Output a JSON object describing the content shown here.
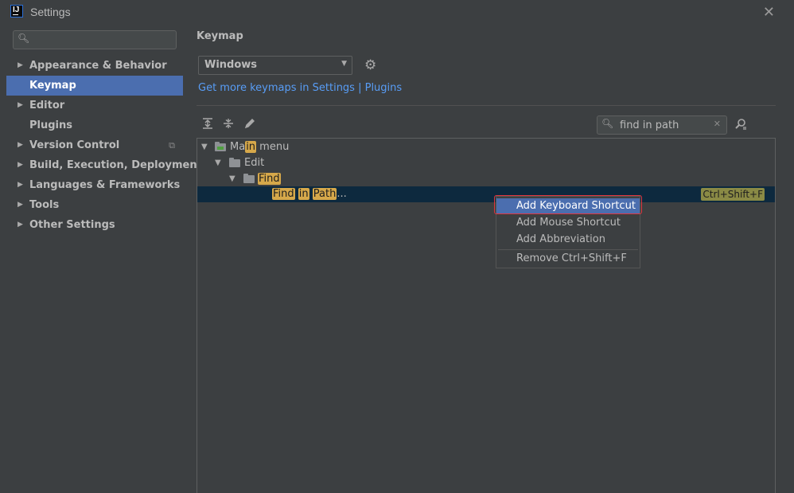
{
  "window": {
    "logo_text": "IJ",
    "title": "Settings",
    "close_glyph": "✕"
  },
  "sidebar": {
    "search": {
      "value": "",
      "placeholder": ""
    },
    "items": [
      {
        "label": "Appearance & Behavior",
        "expandable": true,
        "selected": false
      },
      {
        "label": "Keymap",
        "expandable": false,
        "selected": true
      },
      {
        "label": "Editor",
        "expandable": true,
        "selected": false
      },
      {
        "label": "Plugins",
        "expandable": false,
        "selected": false
      },
      {
        "label": "Version Control",
        "expandable": true,
        "selected": false,
        "icon": "copy-icon"
      },
      {
        "label": "Build, Execution, Deployment",
        "expandable": true,
        "selected": false
      },
      {
        "label": "Languages & Frameworks",
        "expandable": true,
        "selected": false
      },
      {
        "label": "Tools",
        "expandable": true,
        "selected": false
      },
      {
        "label": "Other Settings",
        "expandable": true,
        "selected": false
      }
    ]
  },
  "main": {
    "title": "Keymap",
    "keymap_select": {
      "value": "Windows"
    },
    "more_keymaps_link": "Get more keymaps in Settings | Plugins",
    "toolbar": {
      "icons": [
        "expand-all-icon",
        "collapse-all-icon",
        "edit-icon"
      ],
      "search": {
        "value": "find in path",
        "placeholder": ""
      },
      "find_by_shortcut_icon": "find-shortcut-icon"
    },
    "tree": {
      "rows": [
        {
          "pre": "Ma",
          "hl": "in",
          "post": " menu",
          "icon": "main-menu-folder-icon"
        },
        {
          "label": "Edit",
          "icon": "folder-icon"
        },
        {
          "hl": "Find",
          "icon": "folder-icon"
        },
        {
          "hl1": "Find",
          "hl2": "in",
          "hl3": "Path",
          "suffix": "...",
          "shortcut": "Ctrl+Shift+F",
          "selected": true
        }
      ]
    }
  },
  "context_menu": {
    "items": [
      {
        "label": "Add Keyboard Shortcut",
        "active": true
      },
      {
        "label": "Add Mouse Shortcut",
        "active": false
      },
      {
        "label": "Add Abbreviation",
        "active": false
      },
      {
        "label": "Remove Ctrl+Shift+F",
        "active": false
      }
    ]
  },
  "colors": {
    "background": "#3c3f41",
    "selection_blue": "#4b6eaf",
    "link": "#589df6",
    "highlight": "#d6a84a",
    "annotation_red": "#e0353f"
  }
}
